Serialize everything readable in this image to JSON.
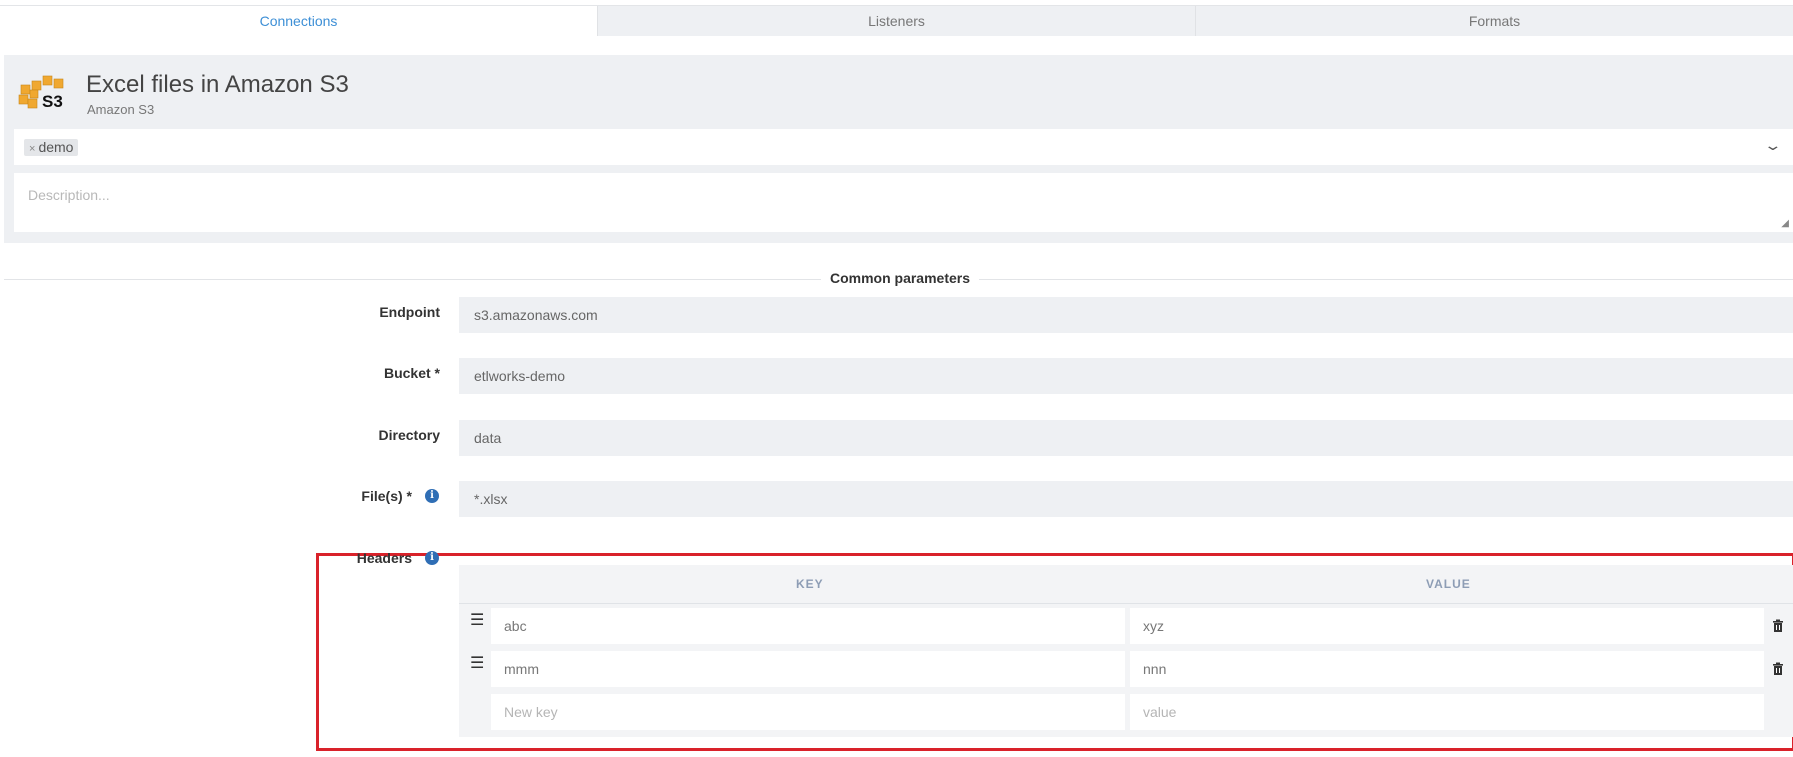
{
  "tabs": [
    {
      "label": "Connections",
      "active": true
    },
    {
      "label": "Listeners",
      "active": false
    },
    {
      "label": "Formats",
      "active": false
    }
  ],
  "connection": {
    "title": "Excel files in Amazon S3",
    "subtitle": "Amazon S3",
    "logo_text": "S3",
    "tags": [
      "demo"
    ],
    "description_placeholder": "Description..."
  },
  "section_title": "Common parameters",
  "fields": {
    "endpoint": {
      "label": "Endpoint",
      "value": "s3.amazonaws.com"
    },
    "bucket": {
      "label": "Bucket *",
      "value": "etlworks-demo"
    },
    "directory": {
      "label": "Directory",
      "value": "data"
    },
    "files": {
      "label": "File(s) *",
      "value": "*.xlsx"
    }
  },
  "headers": {
    "label": "Headers",
    "columns": {
      "key": "KEY",
      "value": "VALUE"
    },
    "rows": [
      {
        "key": "abc",
        "value": "xyz"
      },
      {
        "key": "mmm",
        "value": "nnn"
      }
    ],
    "new_key_placeholder": "New key",
    "new_value_placeholder": "value"
  },
  "colors": {
    "accent": "#3d8fd6",
    "highlight": "#d9222a",
    "info": "#2f6eb5"
  },
  "icons": {
    "drag": "drag-handle-icon",
    "delete": "trash-icon",
    "info": "info-icon",
    "dropdown": "chevron-down-icon"
  }
}
